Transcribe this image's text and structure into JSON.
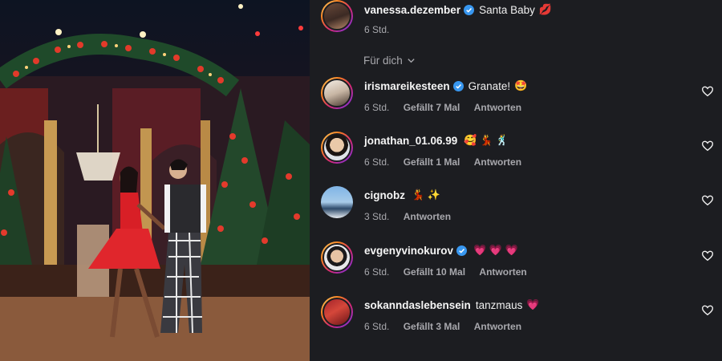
{
  "top_comment": {
    "username": "vanessa.dezember",
    "text": "Santa Baby",
    "emoji": "💋",
    "time": "6 Std."
  },
  "section_label": "Für dich",
  "comments": [
    {
      "username": "irismareikesteen",
      "verified": true,
      "text": "Granate!",
      "emoji": "🤩",
      "time": "6 Std.",
      "likes": "Gefällt 7 Mal",
      "reply": "Antworten"
    },
    {
      "username": "jonathan_01.06.99",
      "verified": false,
      "text": "",
      "emoji": "🥰 💃 🕺",
      "time": "6 Std.",
      "likes": "Gefällt 1 Mal",
      "reply": "Antworten"
    },
    {
      "username": "cignobz",
      "verified": false,
      "text": "",
      "emoji": "💃 ✨",
      "time": "3 Std.",
      "likes": "",
      "reply": "Antworten"
    },
    {
      "username": "evgenyvinokurov",
      "verified": true,
      "text": "",
      "emoji": "💗 💗 💗",
      "time": "6 Std.",
      "likes": "Gefällt 10 Mal",
      "reply": "Antworten"
    },
    {
      "username": "sokanndaslebensein",
      "verified": false,
      "text": "tanzmaus",
      "emoji": "💗",
      "time": "6 Std.",
      "likes": "Gefällt 3 Mal",
      "reply": "Antworten"
    }
  ],
  "colors": {
    "panel_bg": "#1c1d21",
    "verified": "#3897f0",
    "muted_text": "#a8a8ad"
  },
  "icons": {
    "verified": "verified-badge-icon",
    "like": "heart-outline-icon",
    "expand": "chevron-down-icon"
  }
}
